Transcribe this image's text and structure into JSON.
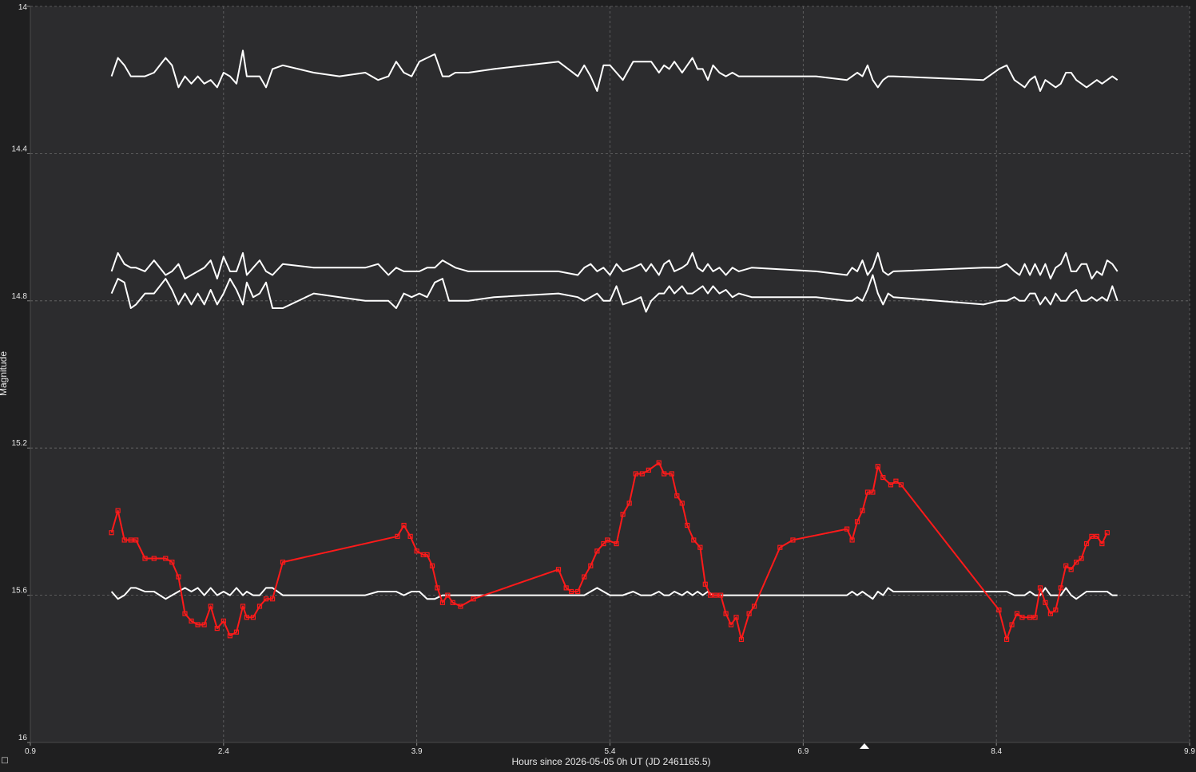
{
  "chart_data": {
    "type": "line",
    "xlabel": "Hours since 2026-05-05 0h UT (JD 2461165.5)",
    "ylabel": "Magnitude",
    "xlim": [
      0.9,
      9.9
    ],
    "ylim": [
      14,
      16
    ],
    "y_inverted": true,
    "grid": true,
    "x_ticks": [
      "0.9",
      "2.4",
      "3.9",
      "5.4",
      "6.9",
      "8.4",
      "9.9"
    ],
    "y_ticks": [
      "14",
      "14.4",
      "14.8",
      "15.2",
      "15.6",
      "16"
    ],
    "colors": {
      "background": "#2c2c2e",
      "grid": "#6a6a6a",
      "target": "#ff1a1a",
      "comparison": "#ffffff"
    },
    "series": [
      {
        "color": "#ffffff",
        "marker": "none",
        "x": [
          1.53,
          1.58,
          1.63,
          1.68,
          1.72,
          1.79,
          1.86,
          1.95,
          2.0,
          2.05,
          2.1,
          2.15,
          2.2,
          2.25,
          2.3,
          2.35,
          2.4,
          2.45,
          2.5,
          2.55,
          2.58,
          2.63,
          2.68,
          2.73,
          2.78,
          2.86,
          3.1,
          3.3,
          3.5,
          3.6,
          3.68,
          3.74,
          3.8,
          3.86,
          3.92,
          3.98,
          4.04,
          4.1,
          4.15,
          4.2,
          4.3,
          4.5,
          5.0,
          5.15,
          5.2,
          5.25,
          5.3,
          5.35,
          5.4,
          5.45,
          5.5,
          5.58,
          5.64,
          5.68,
          5.72,
          5.78,
          5.82,
          5.86,
          5.9,
          5.96,
          6.0,
          6.04,
          6.08,
          6.12,
          6.16,
          6.2,
          6.25,
          6.3,
          6.35,
          6.4,
          6.5,
          7.0,
          7.24,
          7.28,
          7.32,
          7.36,
          7.4,
          7.44,
          7.48,
          7.52,
          7.56,
          7.6,
          8.3,
          8.42,
          8.48,
          8.54,
          8.58,
          8.62,
          8.66,
          8.7,
          8.74,
          8.78,
          8.82,
          8.86,
          8.9,
          8.94,
          8.98,
          9.02,
          9.06,
          9.1,
          9.14,
          9.18,
          9.22,
          9.26,
          9.3,
          9.34
        ],
        "y": [
          14.19,
          14.14,
          14.16,
          14.19,
          14.19,
          14.19,
          14.18,
          14.14,
          14.16,
          14.22,
          14.19,
          14.21,
          14.19,
          14.21,
          14.2,
          14.22,
          14.18,
          14.19,
          14.21,
          14.12,
          14.19,
          14.19,
          14.19,
          14.22,
          14.17,
          14.16,
          14.18,
          14.19,
          14.18,
          14.2,
          14.19,
          14.15,
          14.18,
          14.19,
          14.15,
          14.14,
          14.13,
          14.19,
          14.19,
          14.18,
          14.18,
          14.17,
          14.15,
          14.19,
          14.16,
          14.19,
          14.23,
          14.16,
          14.16,
          14.18,
          14.2,
          14.15,
          14.15,
          14.15,
          14.15,
          14.18,
          14.16,
          14.17,
          14.15,
          14.18,
          14.16,
          14.14,
          14.17,
          14.17,
          14.2,
          14.16,
          14.18,
          14.19,
          14.18,
          14.19,
          14.19,
          14.19,
          14.2,
          14.19,
          14.18,
          14.19,
          14.16,
          14.2,
          14.22,
          14.2,
          14.19,
          14.19,
          14.2,
          14.17,
          14.16,
          14.2,
          14.21,
          14.22,
          14.2,
          14.19,
          14.23,
          14.2,
          14.21,
          14.22,
          14.21,
          14.18,
          14.18,
          14.2,
          14.21,
          14.22,
          14.21,
          14.2,
          14.21,
          14.2,
          14.19,
          14.2
        ]
      },
      {
        "color": "#ffffff",
        "marker": "none",
        "x": [
          1.53,
          1.58,
          1.63,
          1.68,
          1.72,
          1.79,
          1.86,
          1.95,
          2.0,
          2.05,
          2.1,
          2.15,
          2.2,
          2.25,
          2.3,
          2.35,
          2.4,
          2.45,
          2.5,
          2.55,
          2.58,
          2.63,
          2.68,
          2.73,
          2.78,
          2.86,
          3.1,
          3.3,
          3.5,
          3.6,
          3.68,
          3.74,
          3.8,
          3.86,
          3.92,
          3.98,
          4.04,
          4.1,
          4.15,
          4.2,
          4.3,
          4.5,
          5.0,
          5.15,
          5.2,
          5.25,
          5.3,
          5.35,
          5.4,
          5.45,
          5.5,
          5.58,
          5.64,
          5.68,
          5.72,
          5.78,
          5.82,
          5.86,
          5.9,
          5.96,
          6.0,
          6.04,
          6.08,
          6.12,
          6.16,
          6.2,
          6.25,
          6.3,
          6.35,
          6.4,
          6.5,
          7.0,
          7.24,
          7.28,
          7.32,
          7.36,
          7.4,
          7.44,
          7.48,
          7.52,
          7.56,
          7.6,
          8.3,
          8.42,
          8.48,
          8.54,
          8.58,
          8.62,
          8.66,
          8.7,
          8.74,
          8.78,
          8.82,
          8.86,
          8.9,
          8.94,
          8.98,
          9.02,
          9.06,
          9.1,
          9.14,
          9.18,
          9.22,
          9.26,
          9.3,
          9.34
        ],
        "y": [
          14.72,
          14.67,
          14.7,
          14.71,
          14.71,
          14.72,
          14.69,
          14.73,
          14.72,
          14.7,
          14.74,
          14.73,
          14.72,
          14.71,
          14.69,
          14.74,
          14.68,
          14.72,
          14.72,
          14.67,
          14.73,
          14.71,
          14.69,
          14.72,
          14.73,
          14.7,
          14.71,
          14.71,
          14.71,
          14.7,
          14.73,
          14.71,
          14.72,
          14.72,
          14.72,
          14.71,
          14.71,
          14.69,
          14.7,
          14.71,
          14.72,
          14.72,
          14.72,
          14.73,
          14.71,
          14.7,
          14.72,
          14.71,
          14.73,
          14.7,
          14.72,
          14.71,
          14.7,
          14.72,
          14.7,
          14.73,
          14.7,
          14.69,
          14.72,
          14.71,
          14.7,
          14.67,
          14.71,
          14.72,
          14.7,
          14.72,
          14.71,
          14.73,
          14.71,
          14.72,
          14.71,
          14.72,
          14.73,
          14.71,
          14.72,
          14.69,
          14.73,
          14.71,
          14.67,
          14.72,
          14.73,
          14.72,
          14.71,
          14.71,
          14.7,
          14.72,
          14.73,
          14.7,
          14.73,
          14.7,
          14.73,
          14.7,
          14.74,
          14.71,
          14.7,
          14.67,
          14.72,
          14.72,
          14.7,
          14.7,
          14.74,
          14.72,
          14.73,
          14.69,
          14.7,
          14.72
        ]
      },
      {
        "color": "#ffffff",
        "marker": "none",
        "x": [
          1.53,
          1.58,
          1.63,
          1.68,
          1.72,
          1.79,
          1.86,
          1.95,
          2.0,
          2.05,
          2.1,
          2.15,
          2.2,
          2.25,
          2.3,
          2.35,
          2.4,
          2.45,
          2.5,
          2.55,
          2.58,
          2.63,
          2.68,
          2.73,
          2.78,
          2.86,
          3.1,
          3.3,
          3.5,
          3.6,
          3.68,
          3.74,
          3.8,
          3.86,
          3.92,
          3.98,
          4.04,
          4.1,
          4.15,
          4.2,
          4.3,
          4.5,
          5.0,
          5.15,
          5.2,
          5.25,
          5.3,
          5.35,
          5.4,
          5.45,
          5.5,
          5.58,
          5.64,
          5.68,
          5.72,
          5.78,
          5.82,
          5.86,
          5.9,
          5.96,
          6.0,
          6.04,
          6.08,
          6.12,
          6.16,
          6.2,
          6.25,
          6.3,
          6.35,
          6.4,
          6.5,
          7.0,
          7.24,
          7.28,
          7.32,
          7.36,
          7.4,
          7.44,
          7.48,
          7.52,
          7.56,
          7.6,
          8.3,
          8.42,
          8.48,
          8.54,
          8.58,
          8.62,
          8.66,
          8.7,
          8.74,
          8.78,
          8.82,
          8.86,
          8.9,
          8.94,
          8.98,
          9.02,
          9.06,
          9.1,
          9.14,
          9.18,
          9.22,
          9.26,
          9.3,
          9.34
        ],
        "y": [
          14.78,
          14.74,
          14.75,
          14.82,
          14.81,
          14.78,
          14.78,
          14.74,
          14.77,
          14.81,
          14.78,
          14.81,
          14.78,
          14.81,
          14.77,
          14.81,
          14.78,
          14.74,
          14.77,
          14.81,
          14.75,
          14.79,
          14.78,
          14.75,
          14.82,
          14.82,
          14.78,
          14.79,
          14.8,
          14.8,
          14.8,
          14.82,
          14.78,
          14.79,
          14.78,
          14.79,
          14.75,
          14.74,
          14.8,
          14.8,
          14.8,
          14.79,
          14.78,
          14.79,
          14.8,
          14.79,
          14.78,
          14.8,
          14.8,
          14.76,
          14.81,
          14.8,
          14.79,
          14.83,
          14.8,
          14.78,
          14.78,
          14.76,
          14.78,
          14.76,
          14.78,
          14.78,
          14.77,
          14.76,
          14.78,
          14.76,
          14.78,
          14.77,
          14.79,
          14.78,
          14.79,
          14.79,
          14.8,
          14.8,
          14.79,
          14.8,
          14.77,
          14.73,
          14.78,
          14.81,
          14.78,
          14.79,
          14.81,
          14.8,
          14.8,
          14.79,
          14.8,
          14.8,
          14.78,
          14.78,
          14.81,
          14.79,
          14.81,
          14.78,
          14.8,
          14.8,
          14.78,
          14.77,
          14.8,
          14.8,
          14.79,
          14.8,
          14.79,
          14.8,
          14.76,
          14.8
        ]
      },
      {
        "color": "#ffffff",
        "marker": "none",
        "x": [
          1.53,
          1.58,
          1.63,
          1.68,
          1.72,
          1.79,
          1.86,
          1.95,
          2.0,
          2.05,
          2.1,
          2.15,
          2.2,
          2.25,
          2.3,
          2.35,
          2.4,
          2.45,
          2.5,
          2.55,
          2.58,
          2.63,
          2.68,
          2.73,
          2.78,
          2.86,
          3.1,
          3.3,
          3.5,
          3.6,
          3.68,
          3.74,
          3.8,
          3.86,
          3.92,
          3.98,
          4.04,
          4.1,
          4.15,
          4.2,
          4.3,
          4.5,
          5.0,
          5.15,
          5.2,
          5.25,
          5.3,
          5.35,
          5.4,
          5.45,
          5.5,
          5.58,
          5.64,
          5.68,
          5.72,
          5.78,
          5.82,
          5.86,
          5.9,
          5.96,
          6.0,
          6.04,
          6.08,
          6.12,
          6.16,
          6.2,
          6.25,
          6.3,
          6.35,
          6.4,
          6.5,
          7.0,
          7.24,
          7.28,
          7.32,
          7.36,
          7.4,
          7.44,
          7.48,
          7.52,
          7.56,
          7.6,
          8.3,
          8.42,
          8.48,
          8.54,
          8.58,
          8.62,
          8.66,
          8.7,
          8.74,
          8.78,
          8.82,
          8.86,
          8.9,
          8.94,
          8.98,
          9.02,
          9.06,
          9.1,
          9.14,
          9.18,
          9.22,
          9.26,
          9.3,
          9.34
        ],
        "y": [
          15.59,
          15.61,
          15.6,
          15.58,
          15.58,
          15.59,
          15.59,
          15.61,
          15.6,
          15.59,
          15.58,
          15.59,
          15.58,
          15.6,
          15.58,
          15.6,
          15.59,
          15.6,
          15.58,
          15.6,
          15.59,
          15.6,
          15.6,
          15.58,
          15.58,
          15.6,
          15.6,
          15.6,
          15.6,
          15.59,
          15.59,
          15.59,
          15.6,
          15.59,
          15.59,
          15.61,
          15.61,
          15.6,
          15.6,
          15.6,
          15.6,
          15.6,
          15.6,
          15.6,
          15.6,
          15.59,
          15.58,
          15.59,
          15.6,
          15.6,
          15.6,
          15.59,
          15.6,
          15.6,
          15.6,
          15.59,
          15.6,
          15.6,
          15.59,
          15.6,
          15.59,
          15.6,
          15.59,
          15.6,
          15.59,
          15.6,
          15.6,
          15.6,
          15.6,
          15.6,
          15.6,
          15.6,
          15.6,
          15.59,
          15.6,
          15.59,
          15.6,
          15.61,
          15.59,
          15.6,
          15.58,
          15.59,
          15.59,
          15.59,
          15.59,
          15.6,
          15.6,
          15.6,
          15.59,
          15.6,
          15.6,
          15.58,
          15.6,
          15.6,
          15.6,
          15.58,
          15.6,
          15.61,
          15.6,
          15.59,
          15.59,
          15.59,
          15.59,
          15.59,
          15.6,
          15.6
        ]
      },
      {
        "color": "#ff1a1a",
        "marker": "square",
        "x": [
          1.53,
          1.58,
          1.63,
          1.68,
          1.72,
          1.79,
          1.86,
          1.95,
          2.0,
          2.05,
          2.1,
          2.15,
          2.2,
          2.25,
          2.3,
          2.35,
          2.4,
          2.45,
          2.5,
          2.55,
          2.58,
          2.63,
          2.68,
          2.73,
          2.78,
          2.86,
          3.75,
          3.8,
          3.85,
          3.9,
          3.95,
          3.98,
          4.02,
          4.06,
          4.1,
          4.14,
          4.18,
          4.24,
          4.34,
          5.0,
          5.06,
          5.1,
          5.15,
          5.2,
          5.25,
          5.3,
          5.35,
          5.38,
          5.45,
          5.5,
          5.55,
          5.6,
          5.65,
          5.7,
          5.78,
          5.82,
          5.88,
          5.92,
          5.96,
          6.0,
          6.05,
          6.1,
          6.14,
          6.18,
          6.22,
          6.26,
          6.3,
          6.34,
          6.38,
          6.42,
          6.48,
          6.52,
          6.72,
          6.82,
          7.24,
          7.28,
          7.32,
          7.36,
          7.4,
          7.44,
          7.48,
          7.52,
          7.58,
          7.62,
          7.66,
          8.42,
          8.48,
          8.52,
          8.56,
          8.6,
          8.66,
          8.7,
          8.74,
          8.78,
          8.82,
          8.86,
          8.9,
          8.94,
          8.98,
          9.02,
          9.06,
          9.1,
          9.14,
          9.18,
          9.22,
          9.26
        ],
        "y": [
          15.43,
          15.37,
          15.45,
          15.45,
          15.45,
          15.5,
          15.5,
          15.5,
          15.51,
          15.55,
          15.65,
          15.67,
          15.68,
          15.68,
          15.63,
          15.69,
          15.67,
          15.71,
          15.7,
          15.63,
          15.66,
          15.66,
          15.63,
          15.61,
          15.61,
          15.51,
          15.44,
          15.41,
          15.44,
          15.48,
          15.49,
          15.49,
          15.52,
          15.58,
          15.62,
          15.6,
          15.62,
          15.63,
          15.61,
          15.53,
          15.58,
          15.59,
          15.59,
          15.55,
          15.52,
          15.48,
          15.46,
          15.45,
          15.46,
          15.38,
          15.35,
          15.27,
          15.27,
          15.26,
          15.24,
          15.27,
          15.27,
          15.33,
          15.35,
          15.41,
          15.45,
          15.47,
          15.57,
          15.6,
          15.6,
          15.6,
          15.65,
          15.68,
          15.66,
          15.72,
          15.65,
          15.63,
          15.47,
          15.45,
          15.42,
          15.45,
          15.4,
          15.37,
          15.32,
          15.32,
          15.25,
          15.28,
          15.3,
          15.29,
          15.3,
          15.64,
          15.72,
          15.68,
          15.65,
          15.66,
          15.66,
          15.66,
          15.58,
          15.62,
          15.65,
          15.64,
          15.58,
          15.52,
          15.53,
          15.51,
          15.5,
          15.46,
          15.44,
          15.44,
          15.46,
          15.43
        ]
      }
    ]
  }
}
